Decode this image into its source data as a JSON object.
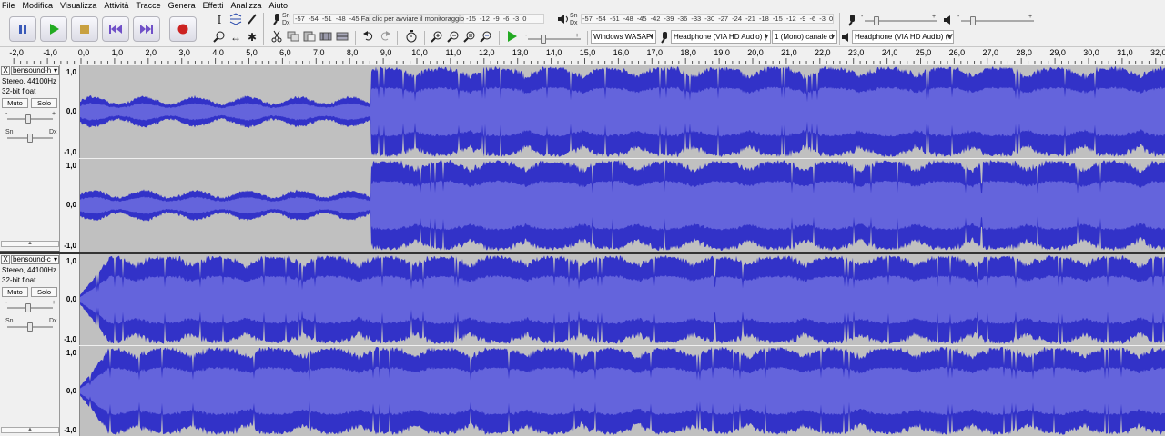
{
  "menu": [
    "File",
    "Modifica",
    "Visualizza",
    "Attività",
    "Tracce",
    "Genera",
    "Effetti",
    "Analizza",
    "Aiuto"
  ],
  "transport": {
    "pause": "pause-icon",
    "play": "play-icon",
    "stop": "stop-icon",
    "skip_start": "skip-start-icon",
    "skip_end": "skip-end-icon",
    "record": "record-icon"
  },
  "tools": {
    "selection": "I",
    "envelope": "envelope-icon",
    "draw": "pencil-icon",
    "zoom": "zoom-icon",
    "timeshift": "↔",
    "multi": "✱"
  },
  "meters": {
    "record_lr": [
      "Sn",
      "Dx"
    ],
    "record_ticks": "-57 -54 -51 -48 -45",
    "record_hint": "Fai clic per avviare il monitoraggio",
    "record_ticks_tail": "-15 -12 -9 -6 -3 0",
    "play_lr": [
      "Sn",
      "Dx"
    ],
    "play_ticks": "-57 -54 -51 -48 -45 -42 -39 -36 -33 -30 -27 -24 -21 -18 -15 -12 -9 -6 -3 0"
  },
  "slider_marks": {
    "rec_minus": "-",
    "rec_plus": "+",
    "play_minus": "-",
    "play_plus": "+"
  },
  "devices": {
    "host": "Windows WASAPI",
    "recording": "Headphone (VIA HD Audio) (",
    "channels": "1 (Mono) canale d",
    "playback": "Headphone (VIA HD Audio) (VIA HD Audio)"
  },
  "ruler": [
    "-2,0",
    "-1,0",
    "0,0",
    "1,0",
    "2,0",
    "3,0",
    "4,0",
    "5,0",
    "6,0",
    "7,0",
    "8,0",
    "9,0",
    "10,0",
    "11,0",
    "12,0",
    "13,0",
    "14,0",
    "15,0",
    "16,0",
    "17,0",
    "18,0",
    "19,0",
    "20,0",
    "21,0",
    "22,0",
    "23,0",
    "24,0",
    "25,0",
    "26,0",
    "27,0",
    "28,0",
    "29,0",
    "30,0",
    "31,0",
    "32,0"
  ],
  "tracks": [
    {
      "name": "bensound-h",
      "rate": "Stereo, 44100Hz",
      "bits": "32-bit float",
      "mute": "Muto",
      "solo": "Solo",
      "gain_minus": "-",
      "gain_plus": "+",
      "pan_left": "Sn",
      "pan_right": "Dx",
      "close": "X",
      "collapse": "▲",
      "scale": [
        "1,0",
        "0,0",
        "-1,0"
      ]
    },
    {
      "name": "bensound-c",
      "rate": "Stereo, 44100Hz",
      "bits": "32-bit float",
      "mute": "Muto",
      "solo": "Solo",
      "gain_minus": "-",
      "gain_plus": "+",
      "pan_left": "Sn",
      "pan_right": "Dx",
      "close": "X",
      "collapse": "▲",
      "scale": [
        "1,0",
        "0,0",
        "-1,0"
      ]
    }
  ],
  "colors": {
    "waveform": "#3232c8",
    "waveform_rms": "#6464dc",
    "background": "#c0c0c0",
    "record": "#cc2222",
    "play": "#22aa22"
  }
}
